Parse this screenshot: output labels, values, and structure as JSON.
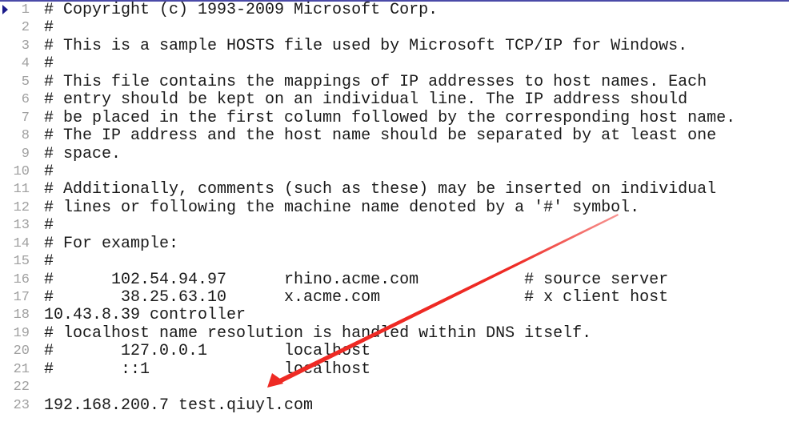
{
  "editor": {
    "lines": [
      "# Copyright (c) 1993-2009 Microsoft Corp.",
      "#",
      "# This is a sample HOSTS file used by Microsoft TCP/IP for Windows.",
      "#",
      "# This file contains the mappings of IP addresses to host names. Each",
      "# entry should be kept on an individual line. The IP address should",
      "# be placed in the first column followed by the corresponding host name.",
      "# The IP address and the host name should be separated by at least one",
      "# space.",
      "#",
      "# Additionally, comments (such as these) may be inserted on individual",
      "# lines or following the machine name denoted by a '#' symbol.",
      "#",
      "# For example:",
      "#",
      "#      102.54.94.97      rhino.acme.com           # source server",
      "#       38.25.63.10      x.acme.com               # x client host",
      "10.43.8.39 controller",
      "# localhost name resolution is handled within DNS itself.",
      "#       127.0.0.1        localhost",
      "#       ::1              localhost",
      "",
      "192.168.200.7 test.qiuyl.com"
    ],
    "line_numbers": [
      "1",
      "2",
      "3",
      "4",
      "5",
      "6",
      "7",
      "8",
      "9",
      "10",
      "11",
      "12",
      "13",
      "14",
      "15",
      "16",
      "17",
      "18",
      "19",
      "20",
      "21",
      "22",
      "23"
    ]
  },
  "annotation": {
    "type": "arrow",
    "color": "#ee2a24"
  },
  "colors": {
    "text": "#1a1a1a",
    "line_number": "#a0a0a0",
    "marker": "#1a1a8a"
  }
}
